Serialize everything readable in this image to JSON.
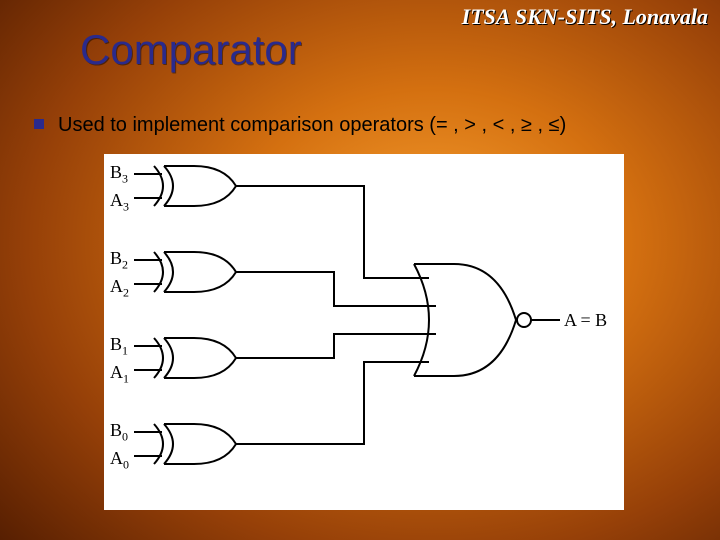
{
  "header": {
    "text": "ITSA SKN-SITS, Lonavala"
  },
  "title": "Comparator",
  "bullet": {
    "text": "Used to implement comparison operators (= , > , < , ≥ , ≤)"
  },
  "diagram": {
    "inputs": [
      {
        "top": "B",
        "top_sub": "3",
        "bottom": "A",
        "bottom_sub": "3"
      },
      {
        "top": "B",
        "top_sub": "2",
        "bottom": "A",
        "bottom_sub": "2"
      },
      {
        "top": "B",
        "top_sub": "1",
        "bottom": "A",
        "bottom_sub": "1"
      },
      {
        "top": "B",
        "top_sub": "0",
        "bottom": "A",
        "bottom_sub": "0"
      }
    ],
    "output": "A = B",
    "gates": "4 XOR gates feeding a 4-input NOR gate"
  },
  "colors": {
    "accent": "#2a2a8c"
  }
}
